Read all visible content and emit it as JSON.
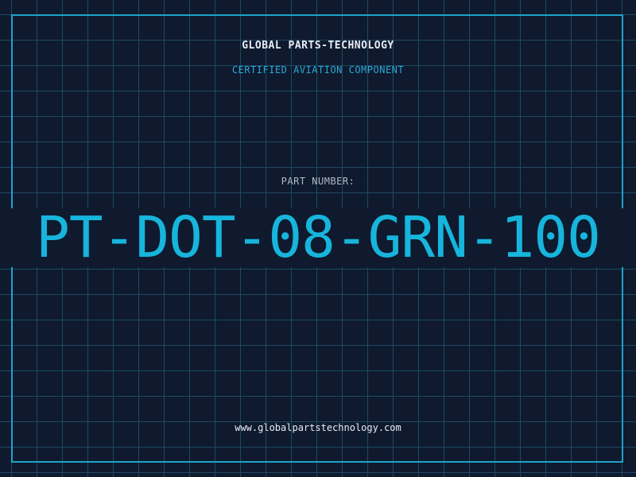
{
  "header": {
    "company": "GLOBAL PARTS-TECHNOLOGY",
    "tagline": "CERTIFIED AVIATION COMPONENT"
  },
  "part": {
    "label": "PART NUMBER:",
    "number": "PT-DOT-08-GRN-100"
  },
  "footer": {
    "website": "www.globalpartstechnology.com"
  },
  "colors": {
    "background": "#0f1a2e",
    "grid": "#1d4a63",
    "accent": "#17b5dc",
    "text": "#e8edf5"
  }
}
